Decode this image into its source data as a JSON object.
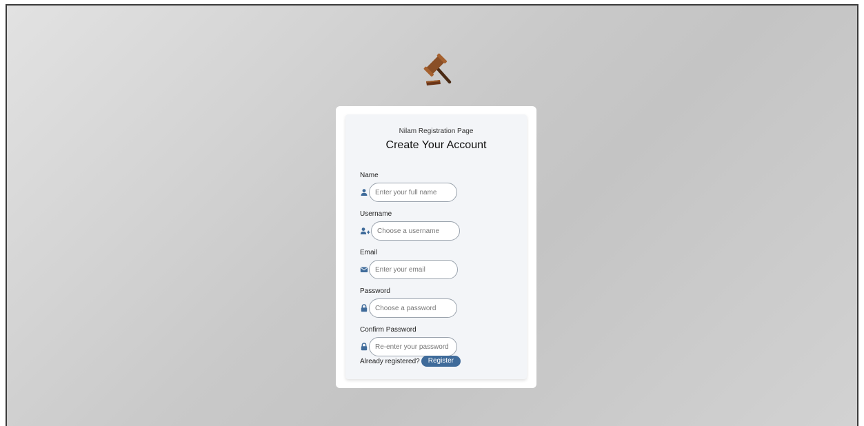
{
  "page": {
    "subtitle": "Nilam Registration Page",
    "title": "Create Your Account"
  },
  "logo": {
    "icon": "gavel-icon"
  },
  "form": {
    "fields": [
      {
        "label": "Name",
        "placeholder": "Enter your full name",
        "value": "",
        "icon": "user-icon"
      },
      {
        "label": "Username",
        "placeholder": "Choose a username",
        "value": "",
        "icon": "user-plus-icon"
      },
      {
        "label": "Email",
        "placeholder": "Enter your email",
        "value": "",
        "icon": "envelope-icon"
      },
      {
        "label": "Password",
        "placeholder": "Choose a password",
        "value": "",
        "icon": "lock-icon"
      },
      {
        "label": "Confirm Password",
        "placeholder": "Re-enter your password",
        "value": "",
        "icon": "lock-icon"
      }
    ],
    "footer_text": "Already registered?",
    "register_label": "Register"
  },
  "colors": {
    "icon": "#3f6b9a",
    "button": "#3f6b9a",
    "card_inner": "#f3f5f8"
  }
}
